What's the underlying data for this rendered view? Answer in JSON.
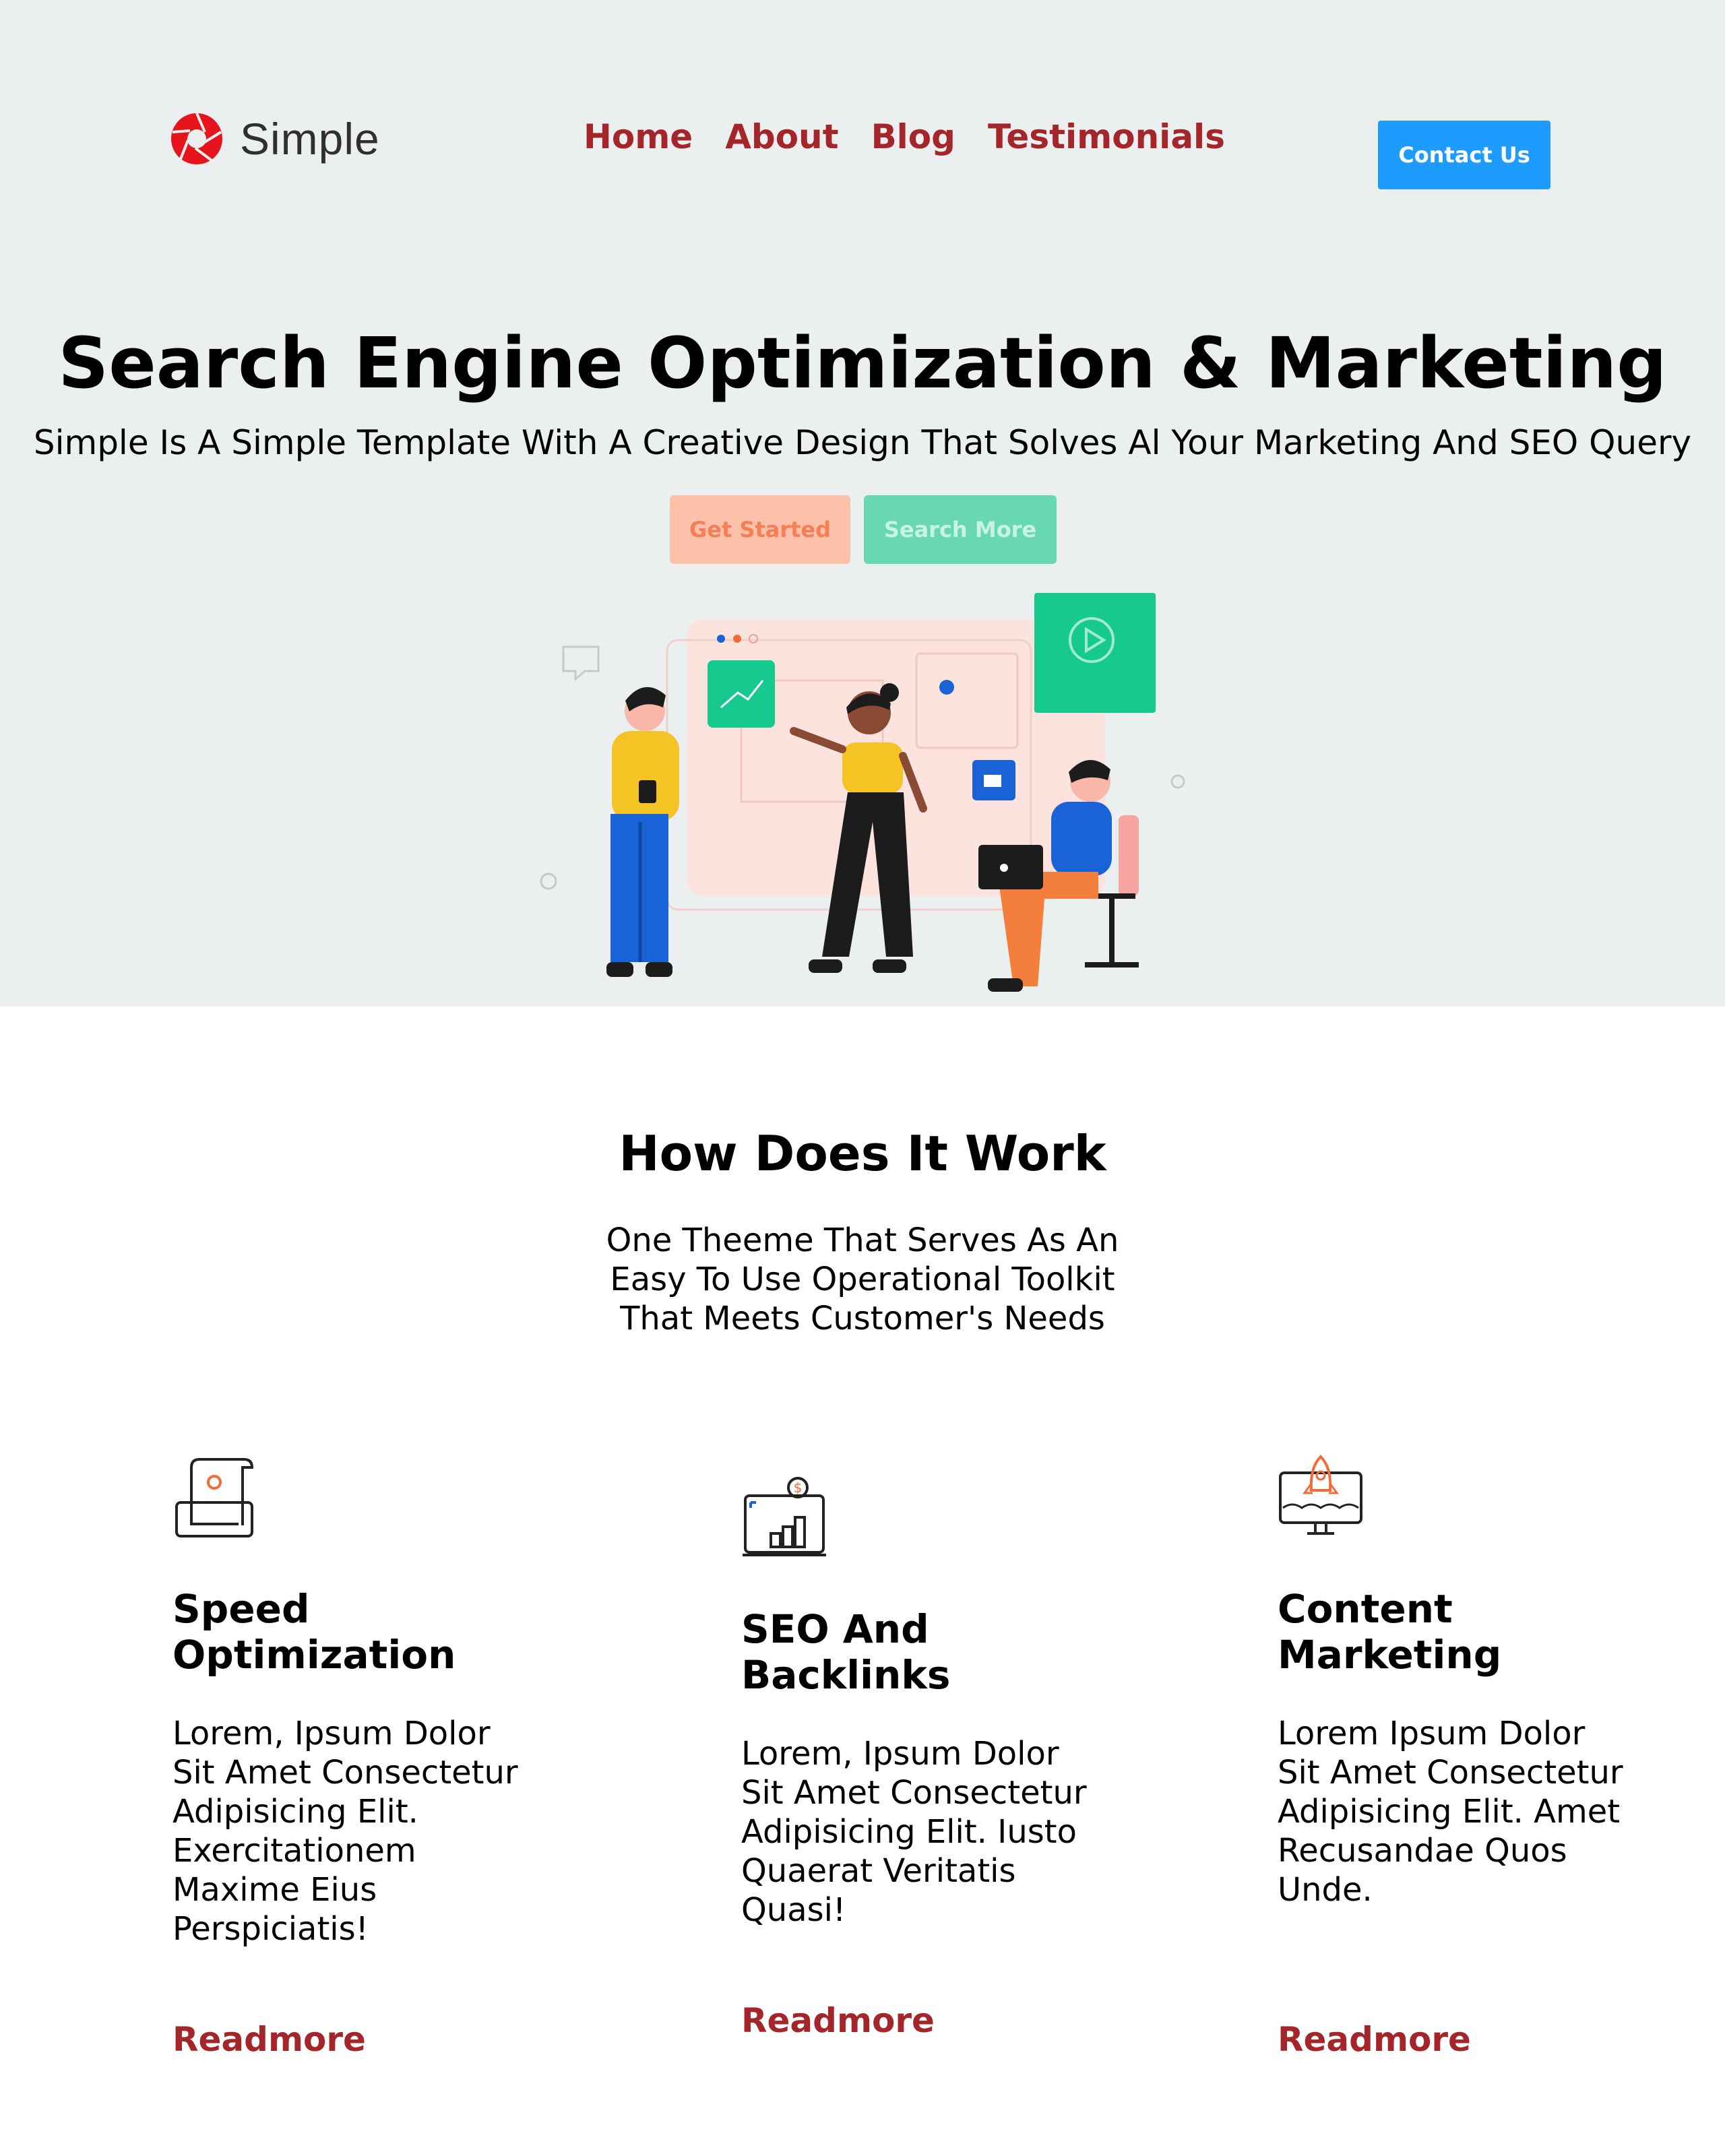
{
  "header": {
    "logo_text": "Simple",
    "nav": [
      "Home",
      "About",
      "Blog",
      "Testimonials"
    ],
    "contact_label": "Contact Us"
  },
  "hero": {
    "title": "Search Engine Optimization & Marketing",
    "subtitle": "Simple Is A Simple Template With A Creative Design That Solves Al Your Marketing And SEO Query",
    "get_started_label": "Get Started",
    "search_more_label": "Search More"
  },
  "how": {
    "title": "How Does It Work",
    "subtitle": "One Theeme That Serves As An Easy To Use Operational Toolkit That Meets Customer's Needs"
  },
  "features": [
    {
      "icon": "document-screen-icon",
      "title": "Speed Optimization",
      "text": "Lorem, Ipsum Dolor Sit Amet Consectetur Adipisicing Elit. Exercitationem Maxime Eius Perspiciatis!",
      "link": "Readmore"
    },
    {
      "icon": "chart-dollar-icon",
      "title": "SEO And Backlinks",
      "text": "Lorem, Ipsum Dolor Sit Amet Consectetur Adipisicing Elit. Iusto Quaerat Veritatis Quasi!",
      "link": "Readmore"
    },
    {
      "icon": "rocket-monitor-icon",
      "title": "Content Marketing",
      "text": "Lorem Ipsum Dolor Sit Amet Consectetur Adipisicing Elit. Amet Recusandae Quos Unde.",
      "link": "Readmore"
    }
  ],
  "colors": {
    "accent_red": "#a5262a",
    "contact_blue": "#1e9bff",
    "hero_bg": "#eceff0",
    "get_started_bg": "#fdc0a8",
    "search_more_bg": "#67d8b3"
  }
}
